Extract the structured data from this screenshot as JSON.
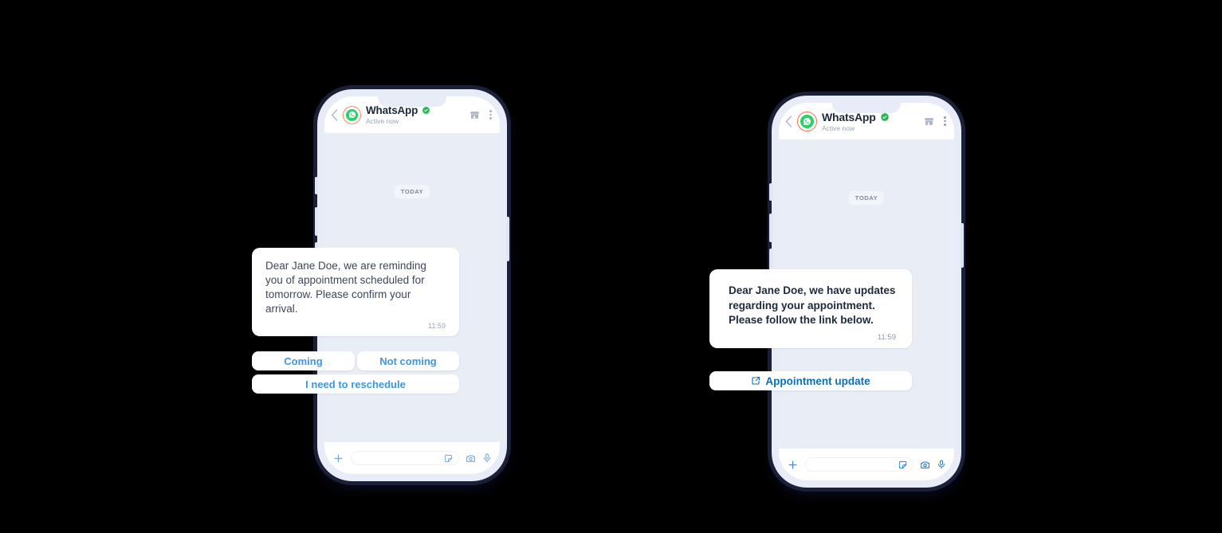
{
  "phones": [
    {
      "id": "left",
      "header": {
        "back_icon": "chevron-left-icon",
        "avatar_icon": "whatsapp-avatar-icon",
        "title": "WhatsApp",
        "verified_icon": "verified-badge-icon",
        "status": "Active now",
        "store_icon": "storefront-icon",
        "menu_icon": "kebab-menu-icon"
      },
      "chat": {
        "date_divider": "TODAY",
        "message": {
          "text": "Dear Jane Doe, we are reminding you of appointment scheduled for tomorrow. Please confirm your arrival.",
          "time": "11:59"
        },
        "quick_replies": [
          {
            "label": "Coming"
          },
          {
            "label": "Not coming"
          },
          {
            "label": "I need to reschedule"
          }
        ]
      },
      "composer": {
        "plus_icon": "plus-icon",
        "input_placeholder": "",
        "input_value": "",
        "sticker_icon": "sticker-icon",
        "camera_icon": "camera-icon",
        "mic_icon": "microphone-icon"
      }
    },
    {
      "id": "right",
      "header": {
        "back_icon": "chevron-left-icon",
        "avatar_icon": "whatsapp-avatar-icon",
        "title": "WhatsApp",
        "verified_icon": "verified-badge-icon",
        "status": "Active now",
        "store_icon": "storefront-icon",
        "menu_icon": "kebab-menu-icon"
      },
      "chat": {
        "date_divider": "TODAY",
        "message": {
          "text": "Dear Jane Doe, we have updates regarding your appointment. Please follow the link below.",
          "time": "11:59"
        },
        "link_button": {
          "icon": "external-link-icon",
          "label": "Appointment update"
        }
      },
      "composer": {
        "plus_icon": "plus-icon",
        "input_placeholder": "",
        "input_value": "",
        "sticker_icon": "sticker-icon",
        "camera_icon": "camera-icon",
        "mic_icon": "microphone-icon"
      }
    }
  ],
  "colors": {
    "background": "#000000",
    "chat_background": "#e9edf5",
    "header_background": "#ffffff",
    "bubble_background": "#ffffff",
    "whatsapp_green": "#25d366",
    "avatar_ring": "#f4886a",
    "verified_green": "#2fb457",
    "reply_blue": "#3b97e3",
    "link_blue": "#0b6fb8",
    "icon_blue": "#6aa9ef",
    "title_text": "#1d2a3b",
    "body_text": "#3c4858",
    "muted_text": "#9aa3b4",
    "frame_dark": "#1b1f38"
  }
}
